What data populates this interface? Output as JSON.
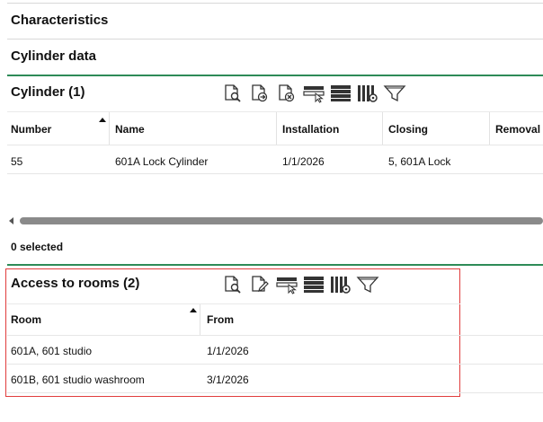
{
  "sections": {
    "characteristics": "Characteristics",
    "cylinder_data": "Cylinder data"
  },
  "cylinder": {
    "title": "Cylinder (1)",
    "columns": [
      "Number",
      "Name",
      "Installation",
      "Closing",
      "Removal"
    ],
    "rows": [
      {
        "number": "55",
        "name": "601A Lock Cylinder",
        "installation": "1/1/2026",
        "closing": "5, 601A Lock",
        "removal": ""
      }
    ],
    "selected": "0 selected",
    "toolbar_icons": [
      "document-search-icon",
      "document-export-icon",
      "document-remove-icon",
      "select-cursor-icon",
      "rows-list-icon",
      "column-settings-icon",
      "filter-icon"
    ]
  },
  "access": {
    "title": "Access to rooms (2)",
    "columns": [
      "Room",
      "From"
    ],
    "rows": [
      {
        "room": "601A, 601 studio",
        "from": "1/1/2026"
      },
      {
        "room": "601B, 601 studio washroom",
        "from": "3/1/2026"
      }
    ],
    "toolbar_icons": [
      "document-search-icon",
      "document-edit-icon",
      "select-cursor-icon",
      "rows-list-icon",
      "column-settings-icon",
      "filter-icon"
    ]
  },
  "colors": {
    "accent_line": "#2e8b57",
    "highlight_border": "#e03c3c"
  }
}
